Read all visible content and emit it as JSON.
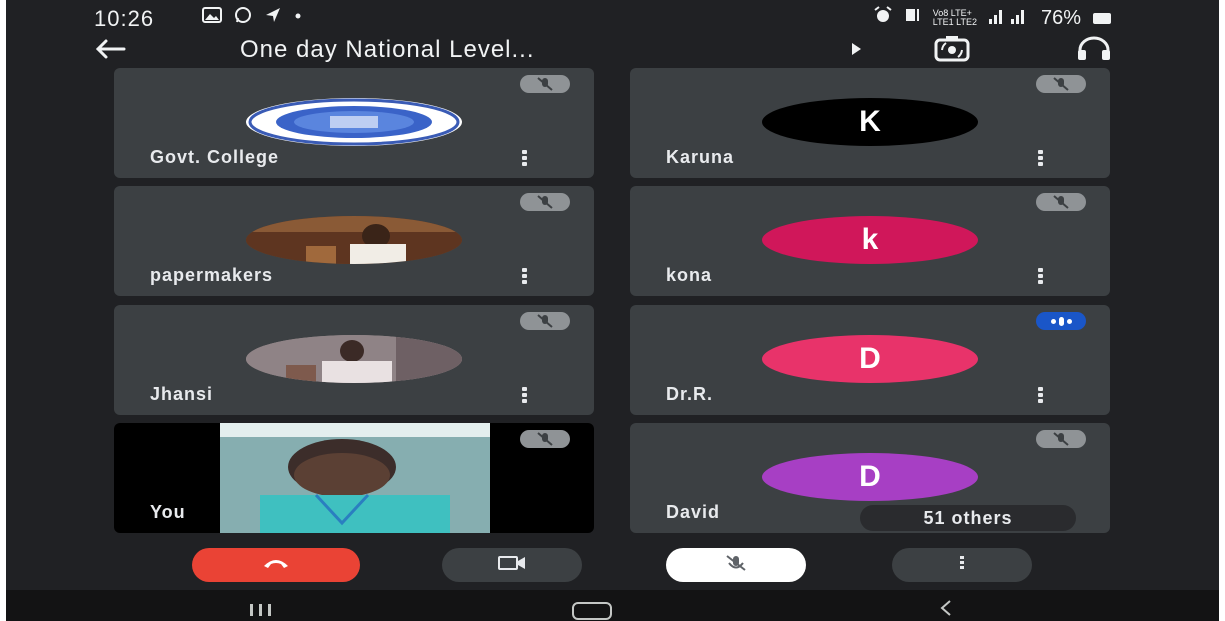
{
  "status_bar": {
    "time": "10:26",
    "left_icons": [
      "image-icon",
      "whatsapp-icon",
      "navigation-icon",
      "dot-icon"
    ],
    "network_small_top": "Vo8 LTE+",
    "network_small_bottom": "LTE1 LTE2",
    "battery": "76%"
  },
  "header": {
    "title": "One day National Level...",
    "icons": [
      "back-arrow-icon",
      "play-arrow-icon",
      "switch-camera-icon",
      "headphones-icon"
    ]
  },
  "participants": [
    {
      "name": "Govt. College",
      "avatar_type": "logo",
      "mic": "muted"
    },
    {
      "name": "Karuna",
      "avatar_type": "initial",
      "initial": "K",
      "color": "#000000",
      "mic": "muted"
    },
    {
      "name": "papermakers",
      "avatar_type": "photo",
      "mic": "muted"
    },
    {
      "name": "kona",
      "avatar_type": "initial",
      "initial": "k",
      "color": "#d0175a",
      "mic": "muted"
    },
    {
      "name": "Jhansi",
      "avatar_type": "photo",
      "mic": "muted"
    },
    {
      "name": "Dr.R.",
      "avatar_type": "initial",
      "initial": "D",
      "color": "#e8336a",
      "mic": "speaking"
    },
    {
      "name": "You",
      "avatar_type": "video",
      "mic": "muted"
    },
    {
      "name": "David",
      "avatar_type": "initial",
      "initial": "D",
      "color": "#a73fc4",
      "mic": "muted"
    }
  ],
  "others_count_label": "51 others",
  "controls": {
    "items": [
      "end-call-icon",
      "camera-icon",
      "mic-off-icon",
      "more-vert-icon"
    ],
    "colors": {
      "end_call": "#ea4335",
      "neutral": "#3c4043",
      "mic": "#ffffff"
    }
  },
  "nav_bar": {
    "items": [
      "recent-apps-icon",
      "home-icon",
      "back-icon"
    ]
  },
  "theme": {
    "background": "#202124",
    "tile": "#3c4043",
    "text": "#e8eaed"
  }
}
